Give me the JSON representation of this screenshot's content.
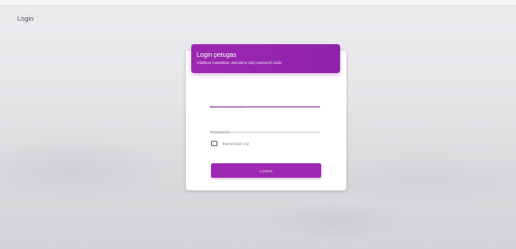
{
  "navbar": {
    "brand": "Login"
  },
  "login_card": {
    "title": "Login petugas",
    "subtitle": "Silahkan masukkan username dan password anda",
    "email_field": {
      "placeholder": "Email or username",
      "value": ""
    },
    "password_field": {
      "placeholder": "Password",
      "value": ""
    },
    "remember_me": {
      "label": "Remember me",
      "checked": false
    },
    "submit_label": "LOGIN"
  },
  "colors": {
    "accent": "#9c27b0",
    "card_background": "#ffffff",
    "page_background": "#e6e6e9"
  }
}
